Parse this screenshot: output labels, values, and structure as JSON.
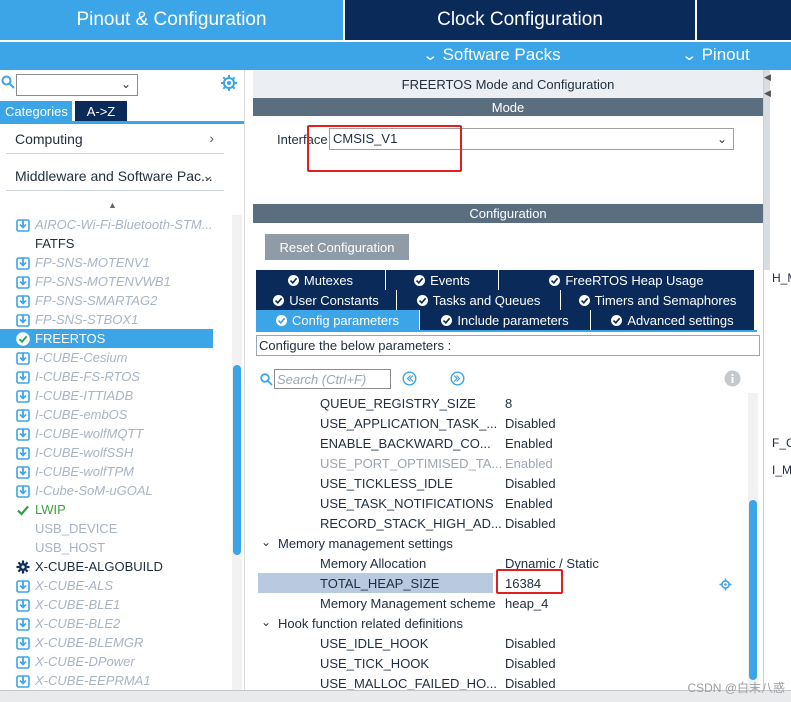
{
  "header": {
    "tabs": [
      "Pinout & Configuration",
      "Clock Configuration",
      ""
    ],
    "software_packs": "Software Packs",
    "pinout": "Pinout"
  },
  "left": {
    "categories_tab": "Categories",
    "az_tab": "A->Z",
    "groups": [
      "Computing",
      "Middleware and Software Pac..."
    ],
    "packages": [
      {
        "label": "AIROC-Wi-Fi-Bluetooth-STM...",
        "style": "disabled",
        "icon": "download-icon"
      },
      {
        "label": "FATFS",
        "style": "normal",
        "icon": ""
      },
      {
        "label": "FP-SNS-MOTENV1",
        "style": "disabled",
        "icon": "download-icon"
      },
      {
        "label": "FP-SNS-MOTENVWB1",
        "style": "disabled",
        "icon": "download-icon"
      },
      {
        "label": "FP-SNS-SMARTAG2",
        "style": "disabled",
        "icon": "download-icon"
      },
      {
        "label": "FP-SNS-STBOX1",
        "style": "disabled",
        "icon": "download-icon"
      },
      {
        "label": "FREERTOS",
        "style": "selected",
        "icon": "check-circle-icon"
      },
      {
        "label": "I-CUBE-Cesium",
        "style": "disabled",
        "icon": "download-icon"
      },
      {
        "label": "I-CUBE-FS-RTOS",
        "style": "disabled",
        "icon": "download-icon"
      },
      {
        "label": "I-CUBE-ITTIADB",
        "style": "disabled",
        "icon": "download-icon"
      },
      {
        "label": "I-CUBE-embOS",
        "style": "disabled",
        "icon": "download-icon"
      },
      {
        "label": "I-CUBE-wolfMQTT",
        "style": "disabled",
        "icon": "download-icon"
      },
      {
        "label": "I-CUBE-wolfSSH",
        "style": "disabled",
        "icon": "download-icon"
      },
      {
        "label": "I-CUBE-wolfTPM",
        "style": "disabled",
        "icon": "download-icon"
      },
      {
        "label": "I-Cube-SoM-uGOAL",
        "style": "disabled",
        "icon": "download-icon"
      },
      {
        "label": "LWIP",
        "style": "green",
        "icon": "check-icon"
      },
      {
        "label": "USB_DEVICE",
        "style": "gray",
        "icon": ""
      },
      {
        "label": "USB_HOST",
        "style": "gray",
        "icon": ""
      },
      {
        "label": "X-CUBE-ALGOBUILD",
        "style": "normal",
        "icon": "gear-icon"
      },
      {
        "label": "X-CUBE-ALS",
        "style": "disabled",
        "icon": "download-icon"
      },
      {
        "label": "X-CUBE-BLE1",
        "style": "disabled",
        "icon": "download-icon"
      },
      {
        "label": "X-CUBE-BLE2",
        "style": "disabled",
        "icon": "download-icon"
      },
      {
        "label": "X-CUBE-BLEMGR",
        "style": "disabled",
        "icon": "download-icon"
      },
      {
        "label": "X-CUBE-DPower",
        "style": "disabled",
        "icon": "download-icon"
      },
      {
        "label": "X-CUBE-EEPRMA1",
        "style": "disabled",
        "icon": "download-icon"
      }
    ]
  },
  "mode": {
    "title": "FREERTOS Mode and Configuration",
    "section": "Mode",
    "interface_label": "Interface",
    "interface_value": "CMSIS_V1"
  },
  "config": {
    "section": "Configuration",
    "reset_label": "Reset Configuration",
    "tabs_row1": [
      "Mutexes",
      "Events",
      "FreeRTOS Heap Usage"
    ],
    "tabs_row2": [
      "User Constants",
      "Tasks and Queues",
      "Timers and Semaphores"
    ],
    "tabs_row3": [
      "Config parameters",
      "Include parameters",
      "Advanced settings"
    ],
    "active_tab": "Config parameters",
    "hint": "Configure the below parameters :",
    "search_placeholder": "Search (Ctrl+F)",
    "rows": [
      {
        "type": "param",
        "name": "QUEUE_REGISTRY_SIZE",
        "value": "8",
        "dim": false
      },
      {
        "type": "param",
        "name": "USE_APPLICATION_TASK_...",
        "value": "Disabled",
        "dim": false
      },
      {
        "type": "param",
        "name": "ENABLE_BACKWARD_CO...",
        "value": "Enabled",
        "dim": false
      },
      {
        "type": "param",
        "name": "USE_PORT_OPTIMISED_TA...",
        "value": "Enabled",
        "dim": true
      },
      {
        "type": "param",
        "name": "USE_TICKLESS_IDLE",
        "value": "Disabled",
        "dim": false
      },
      {
        "type": "param",
        "name": "USE_TASK_NOTIFICATIONS",
        "value": "Enabled",
        "dim": false
      },
      {
        "type": "param",
        "name": "RECORD_STACK_HIGH_AD...",
        "value": "Disabled",
        "dim": false
      },
      {
        "type": "group",
        "name": "Memory management settings"
      },
      {
        "type": "param",
        "name": "Memory Allocation",
        "value": "Dynamic / Static",
        "dim": false
      },
      {
        "type": "param",
        "name": "TOTAL_HEAP_SIZE",
        "value": "16384",
        "dim": false,
        "selected": true
      },
      {
        "type": "param",
        "name": "Memory Management scheme",
        "value": "heap_4",
        "dim": false
      },
      {
        "type": "group",
        "name": "Hook function related definitions"
      },
      {
        "type": "param",
        "name": "USE_IDLE_HOOK",
        "value": "Disabled",
        "dim": false
      },
      {
        "type": "param",
        "name": "USE_TICK_HOOK",
        "value": "Disabled",
        "dim": false
      },
      {
        "type": "param",
        "name": "USE_MALLOC_FAILED_HO...",
        "value": "Disabled",
        "dim": false
      }
    ]
  },
  "far_right": {
    "texts": [
      "H_M",
      "F_C",
      "I_MI"
    ]
  },
  "watermark": "CSDN @白末八惑",
  "colors": {
    "accent": "#3ca5e8",
    "navy": "#0a2a5a",
    "bar": "#5b6e80",
    "highlight_red": "#e02020"
  }
}
